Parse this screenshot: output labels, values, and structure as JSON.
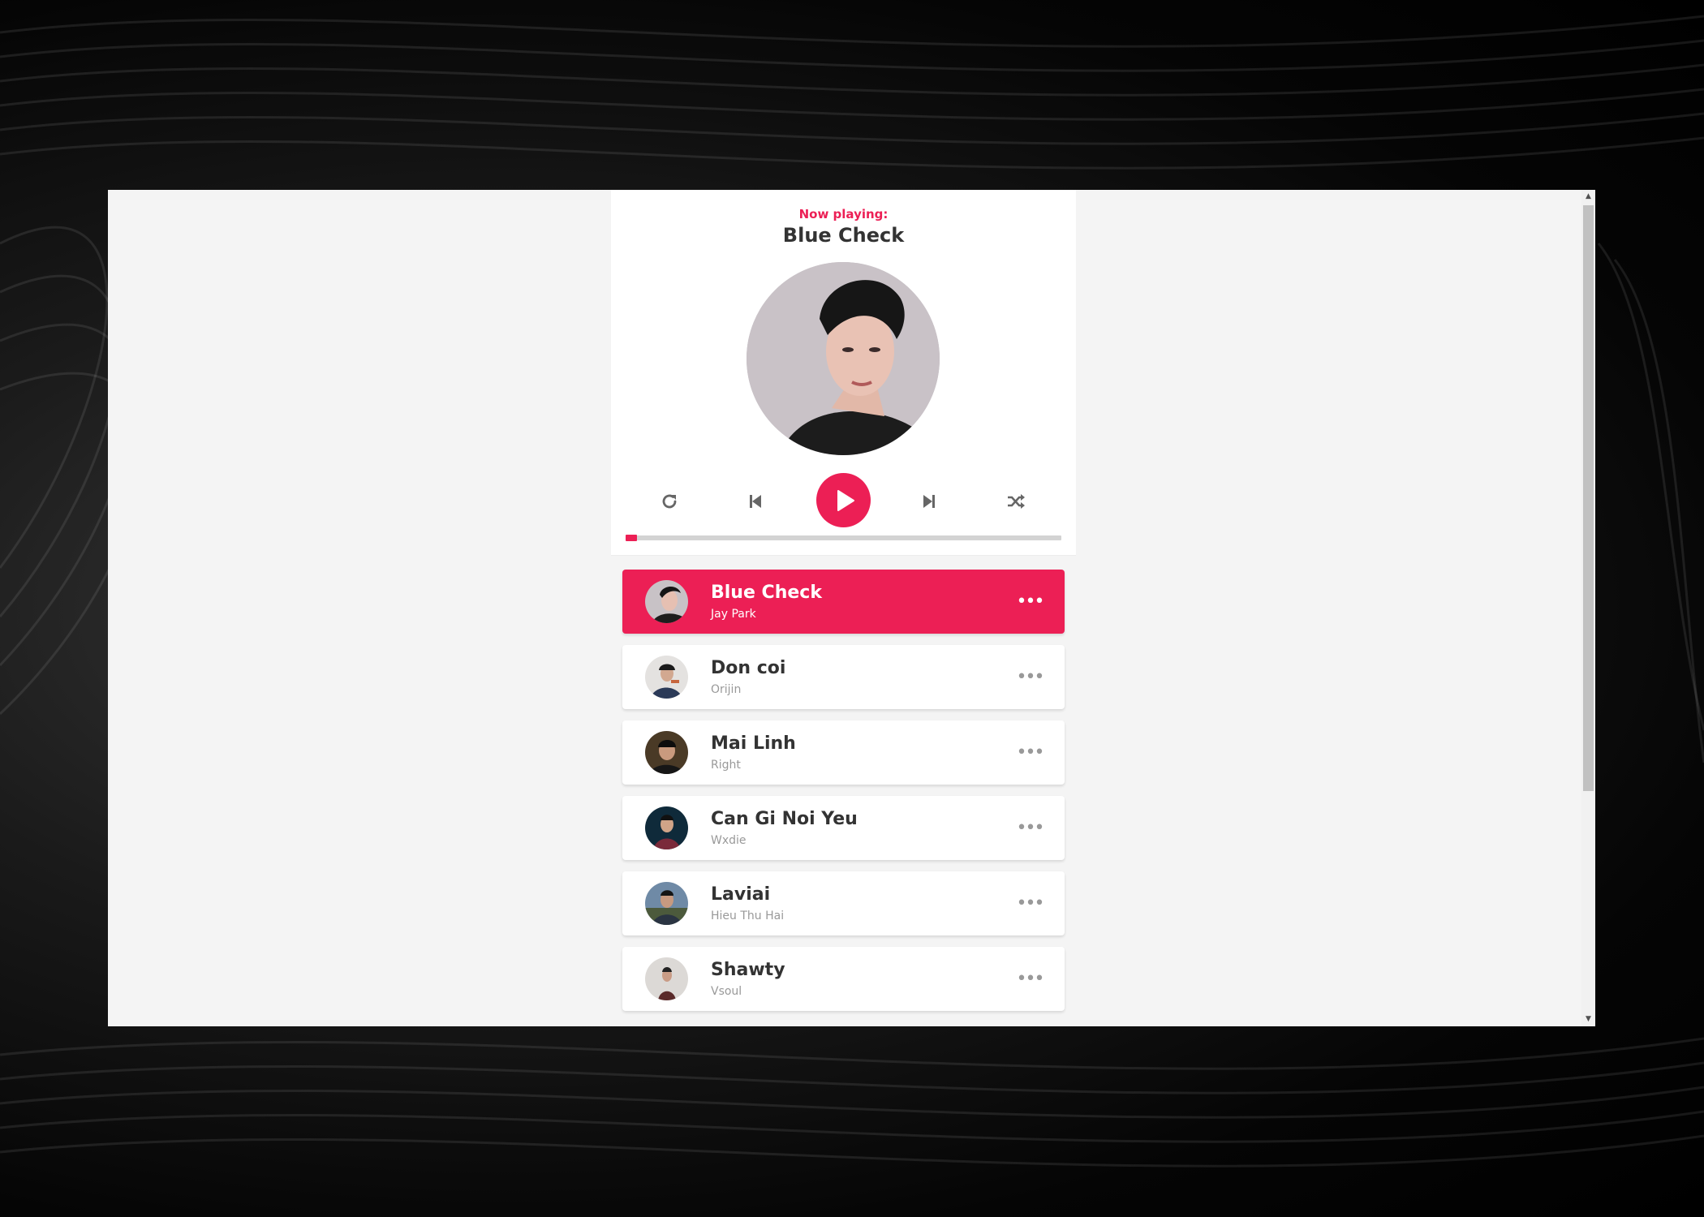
{
  "colors": {
    "primary": "#ec1f55",
    "text": "#333333",
    "muted": "#999999",
    "page_bg": "#f4f4f4"
  },
  "dashboard": {
    "now_playing_label": "Now playing:",
    "current_song": "Blue Check"
  },
  "controls": {
    "repeat_icon": "repeat-icon",
    "prev_icon": "skip-back-icon",
    "play_icon": "play-icon",
    "next_icon": "skip-forward-icon",
    "shuffle_icon": "shuffle-icon"
  },
  "progress": {
    "percent": 2.6
  },
  "playlist": [
    {
      "title": "Blue Check",
      "author": "Jay Park",
      "active": true,
      "option_icon": "more-options-icon"
    },
    {
      "title": "Don coi",
      "author": "Orijin",
      "active": false,
      "option_icon": "more-options-icon"
    },
    {
      "title": "Mai Linh",
      "author": "Right",
      "active": false,
      "option_icon": "more-options-icon"
    },
    {
      "title": "Can Gi Noi Yeu",
      "author": "Wxdie",
      "active": false,
      "option_icon": "more-options-icon"
    },
    {
      "title": "Laviai",
      "author": "Hieu Thu Hai",
      "active": false,
      "option_icon": "more-options-icon"
    },
    {
      "title": "Shawty",
      "author": "Vsoul",
      "active": false,
      "option_icon": "more-options-icon"
    }
  ]
}
